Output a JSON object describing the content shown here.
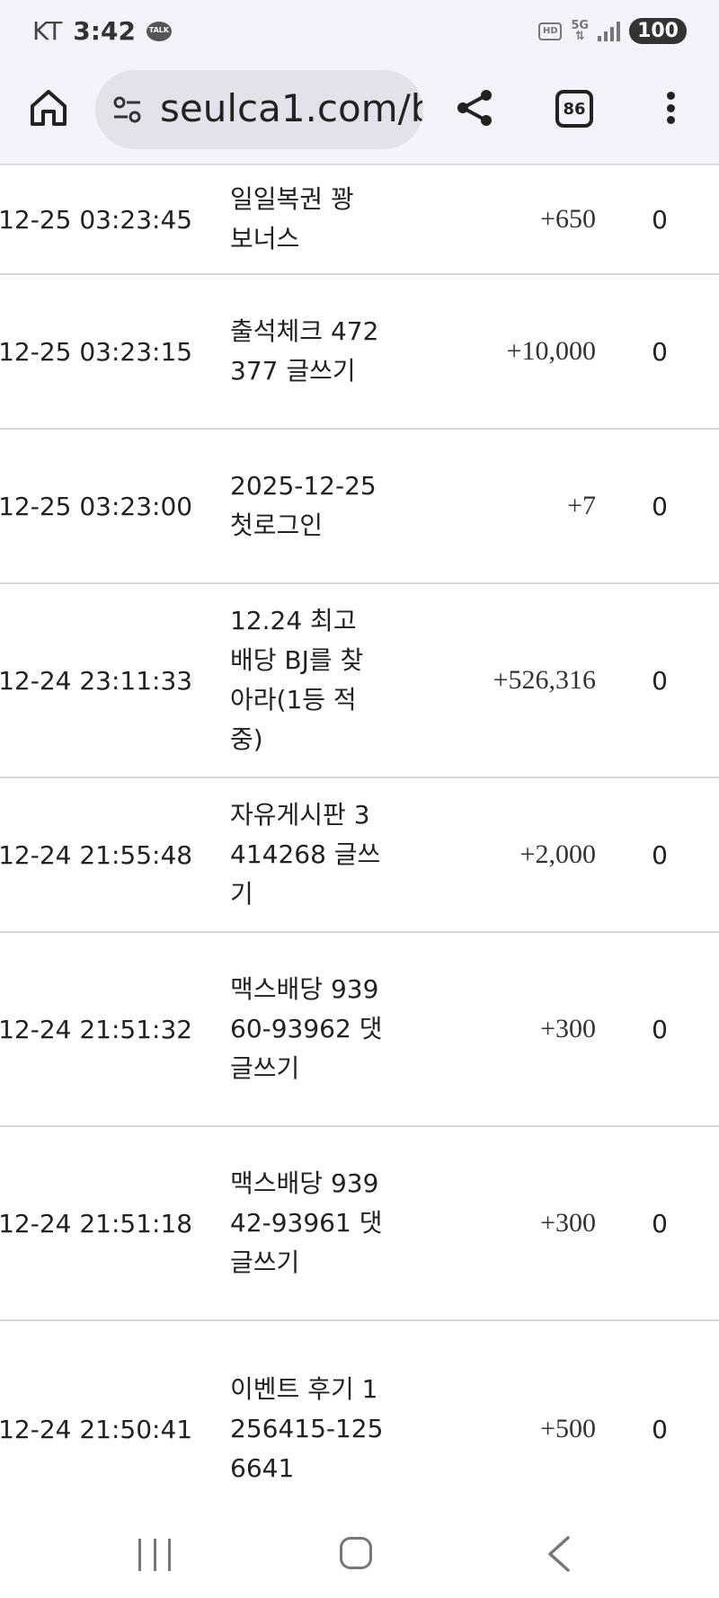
{
  "status_bar": {
    "carrier": "KT",
    "time": "3:42",
    "talk_label": "TALK",
    "hd_label": "HD",
    "network_label": "5G",
    "battery": "100"
  },
  "browser": {
    "url": "seulca1.com/b",
    "tab_count": "86"
  },
  "table": {
    "rows": [
      {
        "date": "-12-25 03:23:45",
        "description": "일일복권 꽝 보너스",
        "points": "+650",
        "balance": "0"
      },
      {
        "date": "-12-25 03:23:15",
        "description": "출석체크 472377 글쓰기",
        "points": "+10,000",
        "balance": "0"
      },
      {
        "date": "-12-25 03:23:00",
        "description": "2025-12-25 첫로그인",
        "points": "+7",
        "balance": "0"
      },
      {
        "date": "-12-24 23:11:33",
        "description": "12.24 최고 배당 BJ를 찾아라(1등 적중)",
        "points": "+526,316",
        "balance": "0"
      },
      {
        "date": "-12-24 21:55:48",
        "description": "자유게시판 3414268 글쓰기",
        "points": "+2,000",
        "balance": "0"
      },
      {
        "date": "-12-24 21:51:32",
        "description": "맥스배당 93960-93962 댓글쓰기",
        "points": "+300",
        "balance": "0"
      },
      {
        "date": "-12-24 21:51:18",
        "description": "맥스배당 93942-93961 댓글쓰기",
        "points": "+300",
        "balance": "0"
      },
      {
        "date": "-12-24 21:50:41",
        "description": "이벤트 후기 1256415-1256641",
        "points": "+500",
        "balance": "0"
      }
    ]
  },
  "icons": {
    "home": "home-icon",
    "site_settings": "tune-icon",
    "share": "share-icon",
    "menu": "more-vert-icon",
    "nav_recent": "recent-apps-icon",
    "nav_home": "home-circle-icon",
    "nav_back": "back-icon"
  }
}
